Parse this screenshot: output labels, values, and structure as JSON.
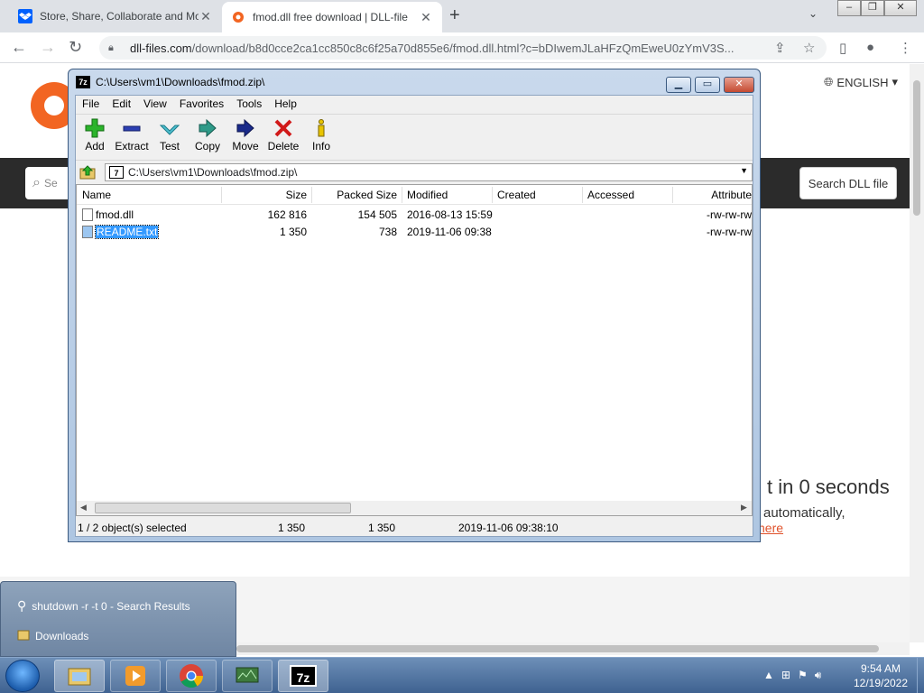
{
  "browser": {
    "tabs": [
      {
        "title": "Store, Share, Collaborate and Mo"
      },
      {
        "title": "fmod.dll free download | DLL-file"
      }
    ],
    "url_domain": "dll-files.com",
    "url_path": "/download/b8d0cce2ca1cc850c8c6f25a70d855e6/fmod.dll.html?c=bDIwemJLaHFzQmEweU0zYmV3S..."
  },
  "webpage": {
    "language": "ENGLISH",
    "search_placeholder": "Se",
    "search_button": "Search DLL file",
    "countdown": "t in 0 seconds",
    "auto_text": "automatically,",
    "here_link": "here"
  },
  "zip_window": {
    "title": "C:\\Users\\vm1\\Downloads\\fmod.zip\\",
    "menu": [
      "File",
      "Edit",
      "View",
      "Favorites",
      "Tools",
      "Help"
    ],
    "tools": [
      {
        "label": "Add",
        "icon": "add-icon"
      },
      {
        "label": "Extract",
        "icon": "extract-icon"
      },
      {
        "label": "Test",
        "icon": "test-icon"
      },
      {
        "label": "Copy",
        "icon": "copy-icon"
      },
      {
        "label": "Move",
        "icon": "move-icon"
      },
      {
        "label": "Delete",
        "icon": "delete-icon"
      },
      {
        "label": "Info",
        "icon": "info-icon"
      }
    ],
    "path": "C:\\Users\\vm1\\Downloads\\fmod.zip\\",
    "columns": [
      "Name",
      "Size",
      "Packed Size",
      "Modified",
      "Created",
      "Accessed",
      "Attribute"
    ],
    "files": [
      {
        "name": "fmod.dll",
        "size": "162 816",
        "packed": "154 505",
        "modified": "2016-08-13 15:59",
        "attr": "-rw-rw-rw",
        "selected": false
      },
      {
        "name": "README.txt",
        "size": "1 350",
        "packed": "738",
        "modified": "2019-11-06 09:38",
        "attr": "-rw-rw-rw",
        "selected": true
      }
    ],
    "status": {
      "selection": "1 / 2 object(s) selected",
      "size": "1 350",
      "packed": "1 350",
      "modified": "2019-11-06 09:38:10"
    }
  },
  "jump_list": [
    {
      "label": "shutdown -r -t 0 - Search Results",
      "icon": "search-icon"
    },
    {
      "label": "Downloads",
      "icon": "folder-icon"
    }
  ],
  "taskbar": {
    "clock_time": "9:54 AM",
    "clock_date": "12/19/2022"
  }
}
